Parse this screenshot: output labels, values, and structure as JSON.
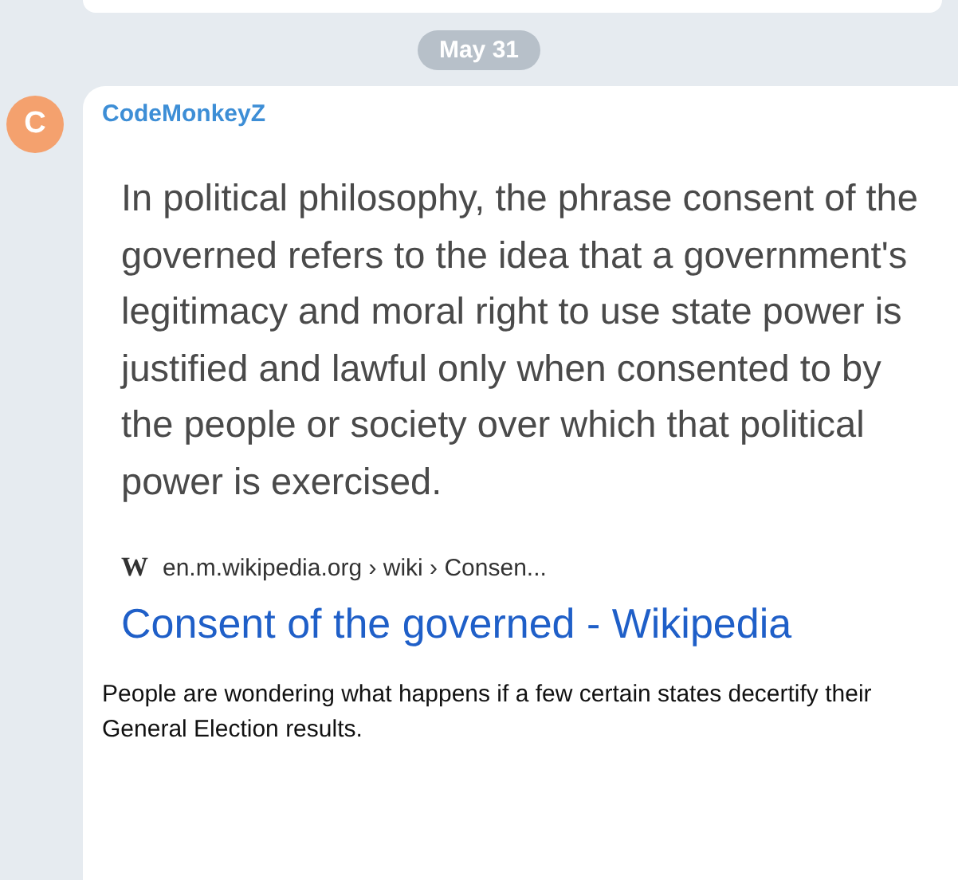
{
  "date_divider": "May 31",
  "message": {
    "avatar_letter": "C",
    "sender": "CodeMonkeyZ",
    "attachment": {
      "paragraph": "In political philosophy, the phrase consent of the governed refers to the idea that a government's legitimacy and moral right to use state power is justified and lawful only when consented to by the people or society over which that political power is exercised.",
      "source_icon": "W",
      "source": "en.m.wikipedia.org › wiki › Consen...",
      "link": "Consent of the governed - Wikipedia"
    },
    "text": "People are wondering what happens if a few certain states decertify their General Election results."
  }
}
